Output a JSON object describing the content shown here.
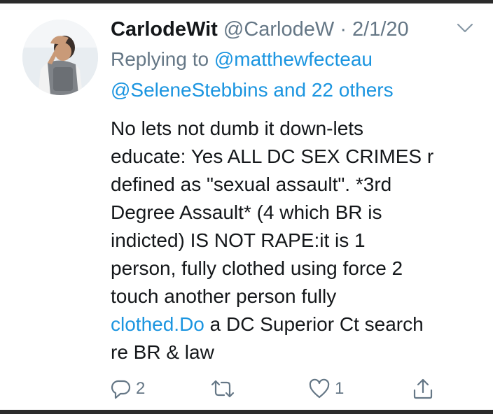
{
  "tweet": {
    "display_name": "CarlodeWit",
    "handle": "@CarlodeW",
    "separator": "·",
    "date": "2/1/20",
    "replying_prefix": "Replying to",
    "replying_to_1": "@matthewfecteau",
    "replying_to_2": "@SeleneStebbins",
    "replying_and": "and",
    "replying_others": "22 others",
    "text_lines": [
      "No lets not dumb it down-lets",
      "educate: Yes ALL DC SEX CRIMES r",
      "defined as \"sexual assault\". *3rd",
      "Degree Assault* (4 which BR is",
      "indicted) IS NOT RAPE:it is 1",
      "person, fully clothed using force 2",
      "touch another person fully"
    ],
    "last_line_link": "clothed.Do",
    "last_line_rest": " a DC Superior Ct search",
    "final_line": "re BR & law",
    "reply_count": "2",
    "retweet_count": "",
    "like_count": "1"
  },
  "icons": {
    "avatar": "profile-photo",
    "menu": "chevron-down-icon",
    "reply": "reply-icon",
    "retweet": "retweet-icon",
    "like": "heart-icon",
    "share": "share-icon"
  },
  "colors": {
    "text": "#14171a",
    "muted": "#657786",
    "link": "#1b95e0",
    "frame": "#2b2b2b"
  }
}
